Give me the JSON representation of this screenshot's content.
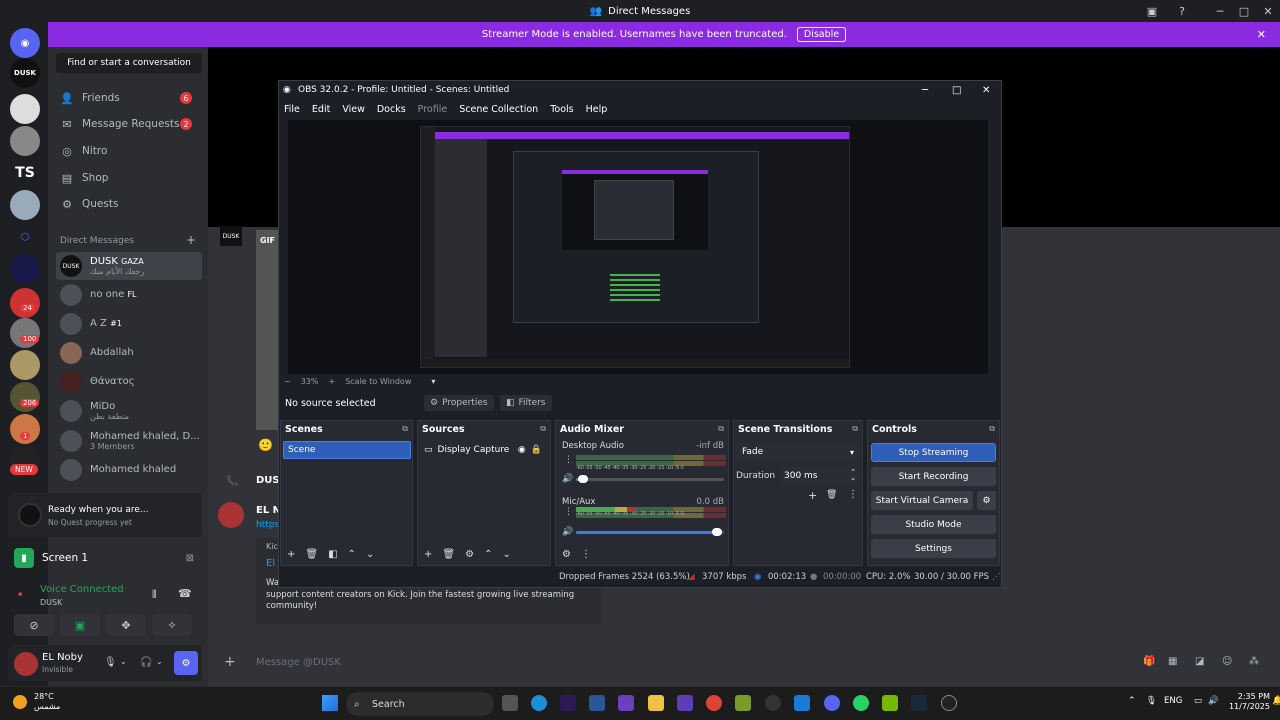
{
  "window": {
    "title": "Direct Messages",
    "banner_text": "Streamer Mode is enabled. Usernames have been truncated.",
    "banner_button": "Disable"
  },
  "rail": {
    "server_label": "DUSK",
    "ts_label": "TS",
    "new_badge": "NEW",
    "badges": [
      "24",
      "100",
      "206",
      "1",
      "1"
    ]
  },
  "sidebar": {
    "find": "Find or start a conversation",
    "nav": [
      {
        "label": "Friends",
        "badge": "6"
      },
      {
        "label": "Message Requests",
        "badge": "2"
      },
      {
        "label": "Nitro"
      },
      {
        "label": "Shop"
      },
      {
        "label": "Quests"
      }
    ],
    "dm_header": "Direct Messages",
    "dms": [
      {
        "name": "DUSK",
        "tag": "GAZA",
        "sub": "رجعك الأيام منك"
      },
      {
        "name": "no one",
        "tag": "FL"
      },
      {
        "name": "A Z",
        "tag": "#1"
      },
      {
        "name": "Abdallah"
      },
      {
        "name": "Θάνατος"
      },
      {
        "name": "MiDo",
        "sub": "متطفة بطن"
      },
      {
        "name": "Mohamed khaled, D...",
        "sub": "3 Members"
      },
      {
        "name": "Mohamed khaled"
      }
    ],
    "quest_title": "Ready when you are...",
    "quest_sub": "No Quest progress yet",
    "screen": "Screen 1",
    "voice_status": "Voice Connected",
    "voice_channel": "DUSK",
    "user_name": "EL Noby",
    "user_status": "Invisible"
  },
  "chat": {
    "author1": "DUS",
    "author2": "EL N",
    "link": "https",
    "gif": "GIF",
    "embed_prefix": "Kick",
    "embed_title": "El",
    "embed_text_1": "Wa",
    "embed_text_2": "support content creators on Kick. Join the fastest growing live streaming community!",
    "input_placeholder": "Message @DUSK"
  },
  "obs": {
    "title": "OBS 32.0.2 - Profile: Untitled - Scenes: Untitled",
    "menu": [
      "File",
      "Edit",
      "View",
      "Docks",
      "Profile",
      "Scene Collection",
      "Tools",
      "Help"
    ],
    "zoom": "33%",
    "scale": "Scale to Window",
    "no_source": "No source selected",
    "properties": "Properties",
    "filters": "Filters",
    "scenes_title": "Scenes",
    "scene_item": "Scene",
    "sources_title": "Sources",
    "source_item": "Display Capture",
    "mixer_title": "Audio Mixer",
    "desktop_audio": "Desktop Audio",
    "desktop_db": "-inf dB",
    "mic_aux": "Mic/Aux",
    "mic_db": "0.0 dB",
    "meter_ticks": "-60 -55 -50 -45 -40 -35 -30 -25 -20 -15 -10 -5 0",
    "transitions_title": "Scene Transitions",
    "transition": "Fade",
    "duration_label": "Duration",
    "duration": "300 ms",
    "controls_title": "Controls",
    "controls": [
      "Stop Streaming",
      "Start Recording",
      "Start Virtual Camera",
      "Studio Mode",
      "Settings"
    ],
    "status": {
      "dropped": "Dropped Frames 2524 (63.5%)",
      "kbps": "3707 kbps",
      "stream_time": "00:02:13",
      "rec_time": "00:00:00",
      "cpu": "CPU: 2.0%",
      "fps": "30.00 / 30.00 FPS"
    }
  },
  "taskbar": {
    "temp": "28°C",
    "weather": "مشمس",
    "search": "Search",
    "lang": "ENG",
    "time": "2:35 PM",
    "date": "11/7/2025"
  },
  "colors": {
    "banner": "#8a2be2",
    "accent": "#3c7ce8",
    "green": "#23a55a",
    "badge": "#e5393e"
  }
}
